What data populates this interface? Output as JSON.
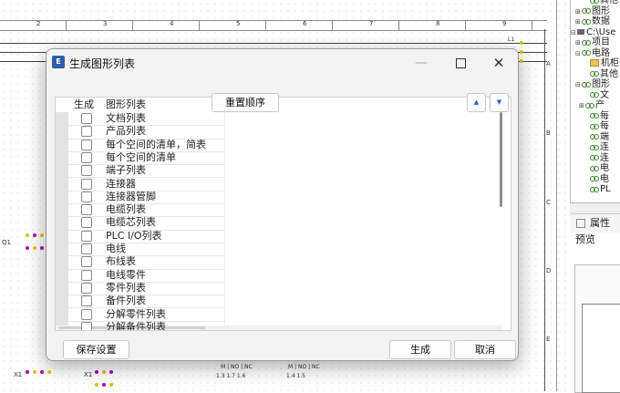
{
  "background": {
    "ruler_numbers": [
      "2",
      "3",
      "4",
      "5",
      "6",
      "7",
      "8",
      "9"
    ],
    "row_letters": [
      "A",
      "B",
      "C",
      "D",
      "E"
    ],
    "labels": {
      "q1": "Q1",
      "x1_left": "X1",
      "x1_mid": "X1",
      "l1": "L1",
      "m_no_nc_1": "M | NO | NC",
      "m_no_nc_2": "M | NO | NC",
      "nums_1": "1.3  1.7  1.6",
      "nums_2": "1.4  1.5"
    }
  },
  "tree": {
    "items": [
      {
        "expander": "",
        "icon": "chain",
        "label": "其他"
      },
      {
        "expander": "⊞",
        "icon": "chain",
        "label": "图形"
      },
      {
        "expander": "⊞",
        "icon": "chain",
        "label": "数据"
      },
      {
        "expander": "⊟",
        "icon": "drive",
        "label": "C:\\Use"
      },
      {
        "expander": "⊞",
        "icon": "chain",
        "label": "项目"
      },
      {
        "expander": "⊟",
        "icon": "chain",
        "label": "电路"
      },
      {
        "expander": "",
        "icon": "folder",
        "label": "机柜"
      },
      {
        "expander": "",
        "icon": "chain",
        "label": "其他"
      },
      {
        "expander": "⊟",
        "icon": "chain",
        "label": "图形"
      },
      {
        "expander": "",
        "icon": "chain",
        "label": "文"
      },
      {
        "expander": "⊞",
        "icon": "chain",
        "label": "产"
      },
      {
        "expander": "",
        "icon": "chain",
        "label": "每"
      },
      {
        "expander": "",
        "icon": "chain",
        "label": "每"
      },
      {
        "expander": "",
        "icon": "chain",
        "label": "端"
      },
      {
        "expander": "",
        "icon": "chain",
        "label": "连"
      },
      {
        "expander": "",
        "icon": "chain",
        "label": "连"
      },
      {
        "expander": "",
        "icon": "chain",
        "label": "电"
      },
      {
        "expander": "",
        "icon": "chain",
        "label": "电"
      },
      {
        "expander": "",
        "icon": "chain",
        "label": "PL"
      }
    ]
  },
  "properties": {
    "tab_label": "属性",
    "preview_label": "预览"
  },
  "dialog": {
    "title": "生成图形列表",
    "app_icon_text": "E",
    "reorder_label": "重置顺序",
    "move_up_label": "▲",
    "move_down_label": "▼",
    "table": {
      "headers": {
        "generate": "生成",
        "list": "图形列表"
      },
      "rows": [
        {
          "label": "文档列表",
          "checked": false
        },
        {
          "label": "产品列表",
          "checked": false
        },
        {
          "label": "每个空间的清单，简表",
          "checked": false
        },
        {
          "label": "每个空间的清单",
          "checked": false
        },
        {
          "label": "端子列表",
          "checked": false
        },
        {
          "label": "连接器",
          "checked": false
        },
        {
          "label": "连接器管脚",
          "checked": false
        },
        {
          "label": "电缆列表",
          "checked": false
        },
        {
          "label": "电缆芯列表",
          "checked": false
        },
        {
          "label": "PLC I/O列表",
          "checked": false
        },
        {
          "label": "电线",
          "checked": false
        },
        {
          "label": "布线表",
          "checked": false
        },
        {
          "label": "电线零件",
          "checked": false
        },
        {
          "label": "零件列表",
          "checked": false
        },
        {
          "label": "备件列表",
          "checked": false
        },
        {
          "label": "分解零件列表",
          "checked": false
        },
        {
          "label": "分解备件列表",
          "checked": false
        }
      ]
    },
    "buttons": {
      "save": "保存设置",
      "generate": "生成",
      "cancel": "取消"
    }
  }
}
